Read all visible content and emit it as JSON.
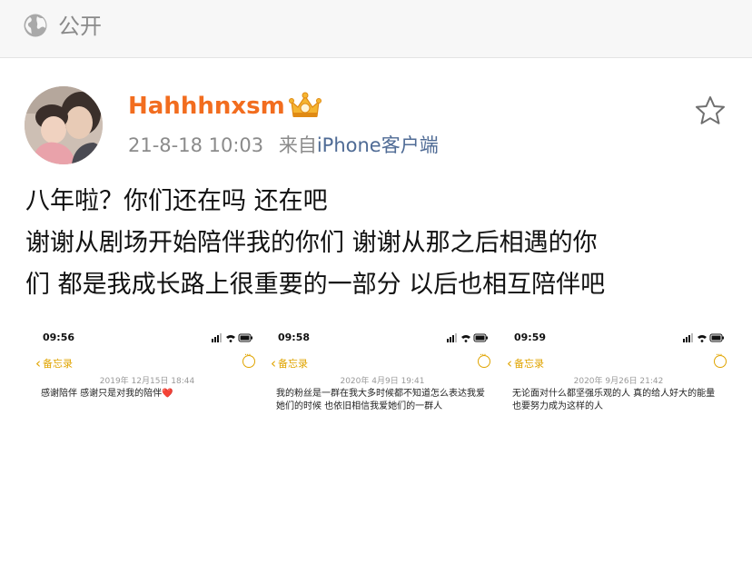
{
  "header": {
    "visibility_icon": "globe-icon",
    "visibility_label": "公开"
  },
  "post": {
    "username": "Hahhhnxsm",
    "badge_icon": "crown-icon",
    "date": "21-8-18 10:03",
    "source_prefix": "来自",
    "source": "iPhone客户端",
    "favorite_icon": "star-icon",
    "lines": [
      "八年啦？你们还在吗 还在吧",
      "谢谢从剧场开始陪伴我的你们 谢谢从那之后相遇的你",
      "们 都是我成长路上很重要的一部分 以后也相互陪伴吧"
    ]
  },
  "screenshots": [
    {
      "time": "09:56",
      "back_label": "备忘录",
      "date": "2019年 12月15日 18:44",
      "text": "感谢陪伴 感谢只是对我的陪伴",
      "heart": "❤️"
    },
    {
      "time": "09:58",
      "back_label": "备忘录",
      "date": "2020年 4月9日 19:41",
      "text": "我的粉丝是一群在我大多时候都不知道怎么表达我爱她们的时候 也依旧相信我爱她们的一群人",
      "heart": ""
    },
    {
      "time": "09:59",
      "back_label": "备忘录",
      "date": "2020年 9月26日 21:42",
      "text": "无论面对什么都坚强乐观的人 真的给人好大的能量 也要努力成为这样的人",
      "heart": ""
    }
  ],
  "colors": {
    "username": "#f26d1f",
    "source_link": "#4f6b95",
    "notes_accent": "#e0a400",
    "meta": "#8b8b8b"
  }
}
